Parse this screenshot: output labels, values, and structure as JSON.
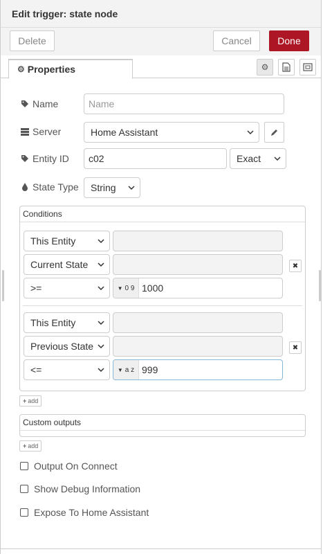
{
  "header": {
    "title": "Edit trigger: state node"
  },
  "toolbar": {
    "delete_label": "Delete",
    "cancel_label": "Cancel",
    "done_label": "Done"
  },
  "tabs": {
    "properties_label": "Properties"
  },
  "form": {
    "name": {
      "label": "Name",
      "placeholder": "Name",
      "value": ""
    },
    "server": {
      "label": "Server",
      "value": "Home Assistant"
    },
    "entity_id": {
      "label": "Entity ID",
      "value": "c02",
      "match": "Exact"
    },
    "state_type": {
      "label": "State Type",
      "value": "String"
    }
  },
  "conditions": {
    "title": "Conditions",
    "rows": [
      {
        "entity_select": "This Entity",
        "state_select": "Current State",
        "operator": ">=",
        "type_glyph": "0 9",
        "value": "1000"
      },
      {
        "entity_select": "This Entity",
        "state_select": "Previous State",
        "operator": "<=",
        "type_glyph": "a z",
        "value": "999"
      }
    ],
    "add_label": "add"
  },
  "custom_outputs": {
    "title": "Custom outputs",
    "add_label": "add"
  },
  "checkboxes": [
    {
      "label": "Output On Connect",
      "checked": false
    },
    {
      "label": "Show Debug Information",
      "checked": false
    },
    {
      "label": "Expose To Home Assistant",
      "checked": false
    }
  ],
  "colors": {
    "primary": "#ad1625",
    "focus_border": "#85b7d9"
  }
}
